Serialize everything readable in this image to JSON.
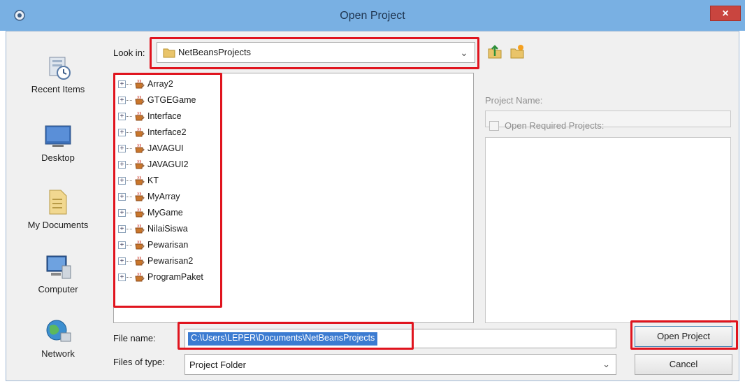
{
  "window": {
    "title": "Open Project",
    "close_label": "×"
  },
  "places": [
    {
      "label": "Recent Items",
      "icon": "recent-items-icon"
    },
    {
      "label": "Desktop",
      "icon": "desktop-icon"
    },
    {
      "label": "My Documents",
      "icon": "my-documents-icon"
    },
    {
      "label": "Computer",
      "icon": "computer-icon"
    },
    {
      "label": "Network",
      "icon": "network-icon"
    }
  ],
  "look_in": {
    "label": "Look in:",
    "value": "NetBeansProjects"
  },
  "tree": {
    "items": [
      {
        "name": "Array2"
      },
      {
        "name": "GTGEGame"
      },
      {
        "name": "Interface"
      },
      {
        "name": "Interface2"
      },
      {
        "name": "JAVAGUI"
      },
      {
        "name": "JAVAGUI2"
      },
      {
        "name": "KT"
      },
      {
        "name": "MyArray"
      },
      {
        "name": "MyGame"
      },
      {
        "name": "NilaiSiswa"
      },
      {
        "name": "Pewarisan"
      },
      {
        "name": "Pewarisan2"
      },
      {
        "name": "ProgramPaket"
      }
    ]
  },
  "right_panel": {
    "project_name_label": "Project Name:",
    "open_required_label": "Open Required Projects:"
  },
  "file_name": {
    "label": "File name:",
    "value": "C:\\Users\\LEPER\\Documents\\NetBeansProjects"
  },
  "files_of_type": {
    "label": "Files of type:",
    "value": "Project Folder"
  },
  "buttons": {
    "open": "Open Project",
    "cancel": "Cancel"
  },
  "colors": {
    "titlebar": "#79b0e3",
    "close": "#c9453f",
    "selection": "#3b7bd1",
    "highlight": "#e0141e"
  }
}
